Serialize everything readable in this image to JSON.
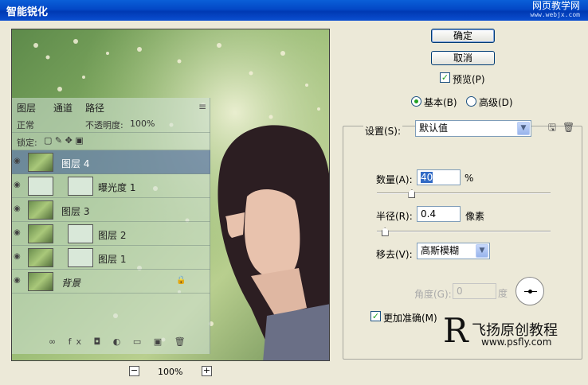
{
  "dialog": {
    "title": "智能锐化",
    "watermark_line1": "网页教学网",
    "watermark_line2": "www.webjx.com"
  },
  "preview": {
    "zoom_out": "−",
    "zoom_in": "+",
    "zoom_level": "100%",
    "layers_panel": {
      "tabs": [
        "图层",
        "通道",
        "路径"
      ],
      "blend_mode": "正常",
      "opacity_label": "不透明度:",
      "opacity_value": "100%",
      "lock_label": "锁定:",
      "layers": [
        {
          "name": "图层 4",
          "selected": true
        },
        {
          "name": "曝光度 1",
          "selected": false
        },
        {
          "name": "图层 3",
          "selected": false
        },
        {
          "name": "图层 2",
          "selected": false
        },
        {
          "name": "图层 1",
          "selected": false
        },
        {
          "name": "背景",
          "selected": false
        }
      ]
    }
  },
  "buttons": {
    "ok": "确定",
    "cancel": "取消"
  },
  "preview_check": {
    "label": "预览(P)",
    "checked": true
  },
  "mode": {
    "basic": "基本(B)",
    "advanced": "高级(D)",
    "selected": "basic"
  },
  "settings": {
    "label": "设置(S):",
    "value": "默认值"
  },
  "amount": {
    "label": "数量(A):",
    "value": "40",
    "unit": "%",
    "slider_fraction": 0.08
  },
  "radius": {
    "label": "半径(R):",
    "value": "0.4",
    "unit": "像素",
    "slider_fraction": 0.04
  },
  "remove": {
    "label": "移去(V):",
    "value": "高斯模糊"
  },
  "angle": {
    "label": "角度(G):",
    "value": "0",
    "unit": "度"
  },
  "accurate": {
    "label": "更加准确(M)",
    "checked": true
  },
  "logo": {
    "letter": "R",
    "title": "飞扬原创教程",
    "url": "www.psfly.com"
  }
}
